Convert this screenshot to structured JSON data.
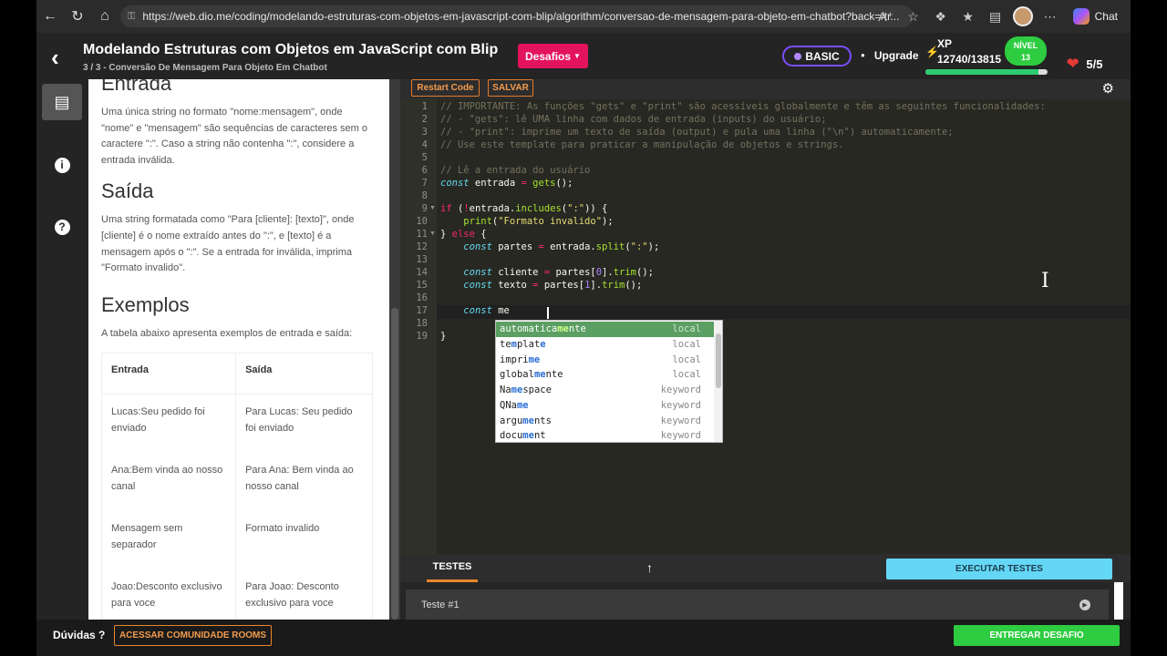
{
  "browser": {
    "url": "https://web.dio.me/coding/modelando-estruturas-com-objetos-em-javascript-com-blip/algorithm/conversao-de-mensagem-para-objeto-em-chatbot?back=/tr...",
    "chat_label": "Chat"
  },
  "header": {
    "title": "Modelando Estruturas com Objetos em JavaScript com Blip",
    "subtitle": "3 / 3 - Conversão De Mensagem Para Objeto Em Chatbot",
    "desafios_label": "Desafios",
    "plan_badge": "BASIC",
    "upgrade_label": "Upgrade",
    "xp_label": "XP",
    "xp_value": "12740/13815",
    "xp_progress": 0.922,
    "level_label": "NÍVEL",
    "level_value": "13",
    "lives": "5/5"
  },
  "description": {
    "entrada_heading": "Entrada",
    "entrada_text": "Uma única string no formato \"nome:mensagem\", onde \"nome\" e \"mensagem\" são sequências de caracteres sem o caractere \":\". Caso a string não contenha \":\", considere a entrada inválida.",
    "saida_heading": "Saída",
    "saida_text": "Uma string formatada como \"Para [cliente]: [texto]\", onde [cliente] é o nome extraído antes do \":\", e [texto] é a mensagem após o \":\". Se a entrada for inválida, imprima \"Formato invalido\".",
    "exemplos_heading": "Exemplos",
    "exemplos_text": "A tabela abaixo apresenta exemplos de entrada e saída:",
    "table": {
      "headers": [
        "Entrada",
        "Saída"
      ],
      "rows": [
        [
          "Lucas:Seu pedido foi enviado",
          "Para Lucas: Seu pedido foi enviado"
        ],
        [
          "Ana:Bem vinda ao nosso canal",
          "Para Ana: Bem vinda ao nosso canal"
        ],
        [
          "Mensagem sem separador",
          "Formato invalido"
        ],
        [
          "Joao:Desconto exclusivo para voce",
          "Para Joao: Desconto exclusivo para voce"
        ]
      ]
    }
  },
  "toolbar": {
    "restart_label": "Restart Code",
    "save_label": "SALVAR"
  },
  "editor": {
    "line_numbers": [
      "1",
      "2",
      "3",
      "4",
      "5",
      "6",
      "7",
      "8",
      "9",
      "10",
      "11",
      "12",
      "13",
      "14",
      "15",
      "16",
      "17",
      "18",
      "19"
    ],
    "lines": {
      "l1": "// IMPORTANTE: As funções \"gets\" e \"print\" são acessíveis globalmente e têm as seguintes funcionalidades:",
      "l2": "// - \"gets\": lê UMA linha com dados de entrada (inputs) do usuário;",
      "l3": "// - \"print\": imprime um texto de saída (output) e pula uma linha (\"\\n\") automaticamente;",
      "l4": "// Use este template para praticar a manipulação de objetos e strings.",
      "l6": "// Lê a entrada do usuário"
    }
  },
  "autocomplete": {
    "items": [
      {
        "pre": "automatica",
        "match": "me",
        "post": "nte",
        "meta": "local"
      },
      {
        "pre": "te",
        "match": "m",
        "post": "plat",
        "post2": "e",
        "meta": "local"
      },
      {
        "pre": "impri",
        "match": "me",
        "post": "",
        "meta": "local"
      },
      {
        "pre": "global",
        "match": "me",
        "post": "nte",
        "meta": "local"
      },
      {
        "pre": "Na",
        "match": "me",
        "post": "space",
        "meta": "keyword"
      },
      {
        "pre": "QNa",
        "match": "me",
        "post": "",
        "meta": "keyword"
      },
      {
        "pre": "argu",
        "match": "me",
        "post": "nts",
        "meta": "keyword"
      },
      {
        "pre": "docu",
        "match": "me",
        "post": "nt",
        "meta": "keyword"
      }
    ]
  },
  "tests": {
    "tab_label": "TESTES",
    "run_label": "EXECUTAR TESTES",
    "test_1": "Teste #1"
  },
  "footer": {
    "duvidas": "Dúvidas ?",
    "community_label": "ACESSAR COMUNIDADE ROOMS",
    "submit_label": "ENTREGAR DESAFIO"
  },
  "colors": {
    "desafios": "#e4135d",
    "accent_orange": "#e8872b",
    "run_tests": "#64d7f7",
    "submit": "#2ecc40"
  },
  "icons": [
    "back-arrow-icon",
    "forward-arrow-icon",
    "reload-icon",
    "home-icon",
    "lock-icon",
    "book-icon",
    "info-icon",
    "help-icon",
    "gear-icon",
    "expand-up-icon",
    "play-icon",
    "heart-icon",
    "bolt-icon"
  ]
}
